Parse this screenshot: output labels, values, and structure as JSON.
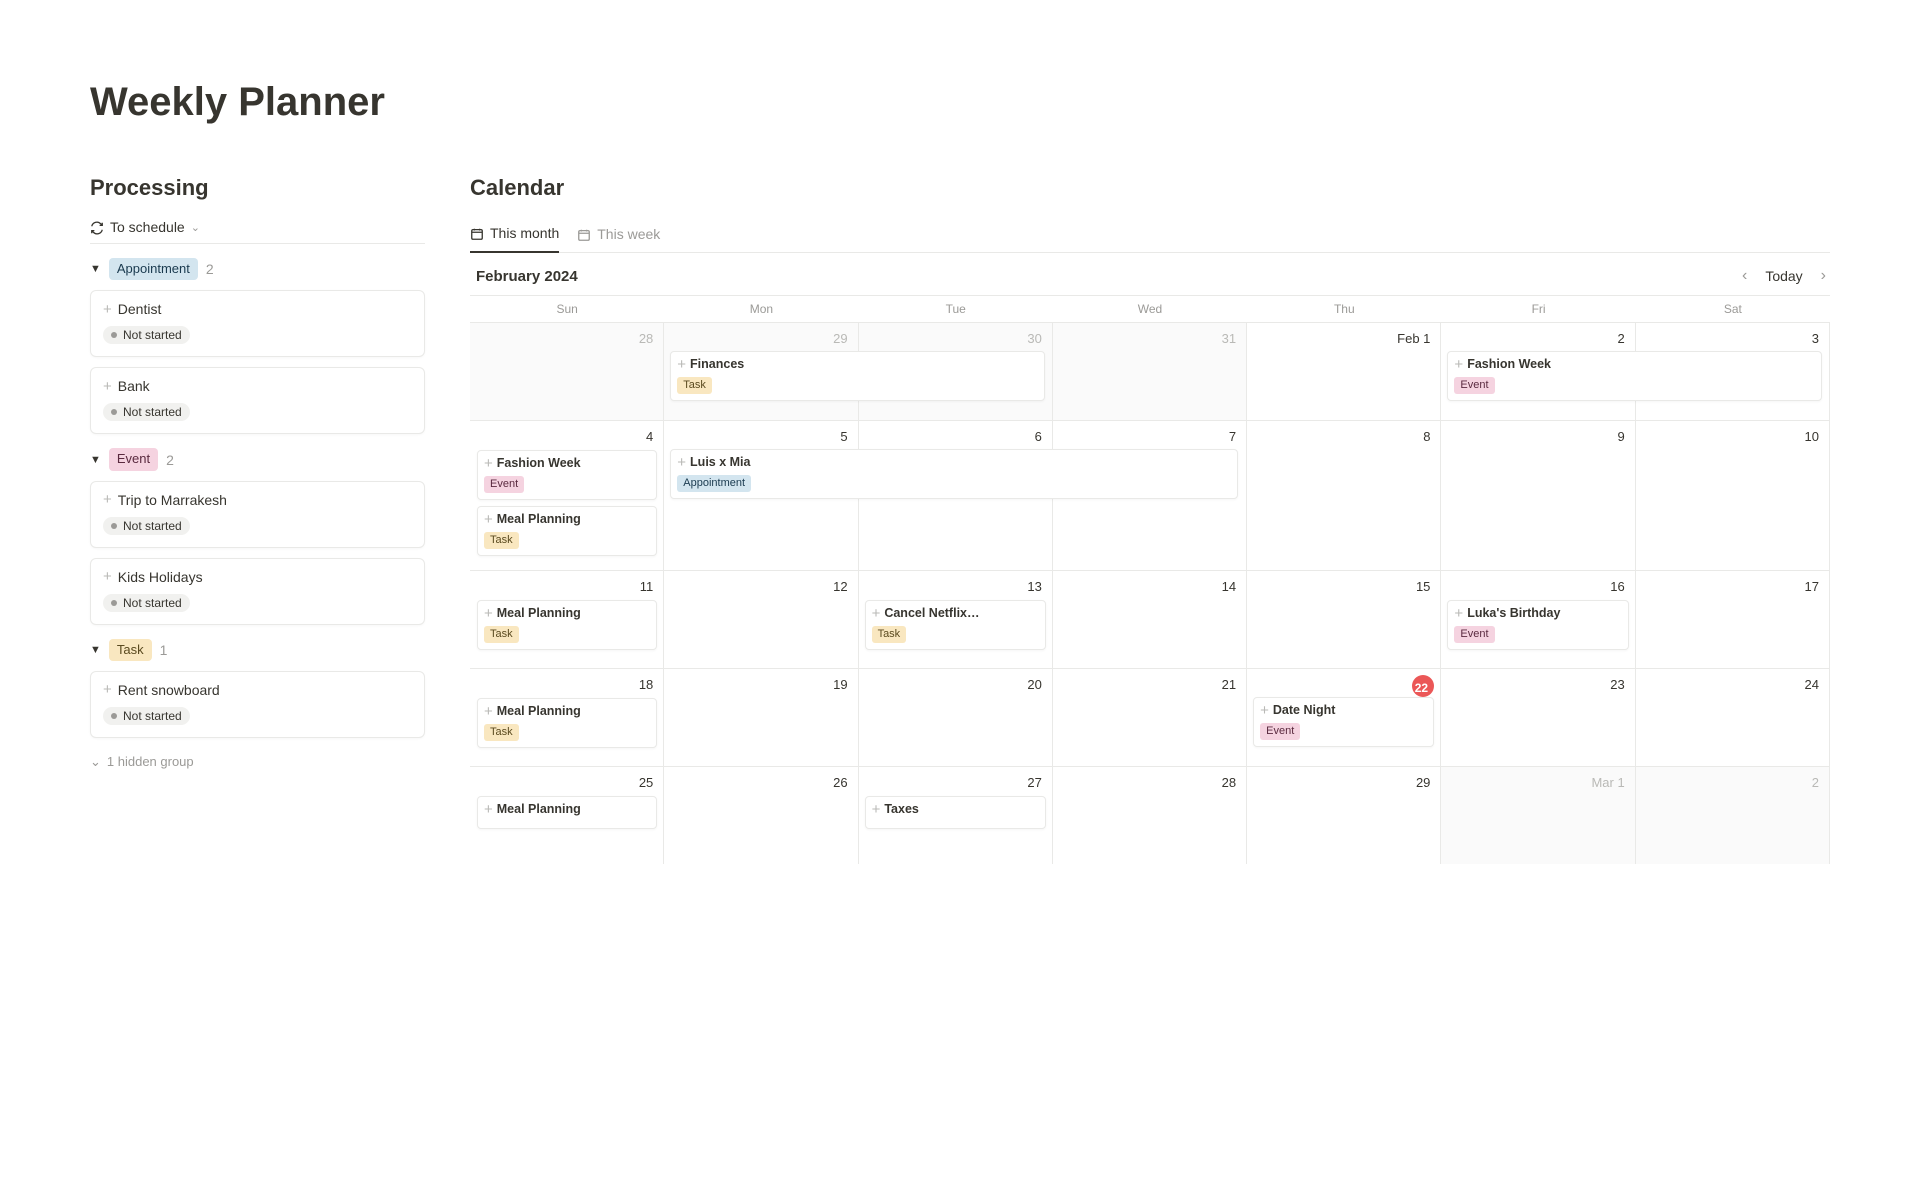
{
  "page_title": "Weekly Planner",
  "processing": {
    "title": "Processing",
    "view_tab": "To schedule",
    "groups": [
      {
        "name": "Appointment",
        "pill_class": "pill-appointment",
        "count": "2",
        "cards": [
          {
            "title": "Dentist",
            "status": "Not started"
          },
          {
            "title": "Bank",
            "status": "Not started"
          }
        ]
      },
      {
        "name": "Event",
        "pill_class": "pill-event",
        "count": "2",
        "cards": [
          {
            "title": "Trip to Marrakesh",
            "status": "Not started"
          },
          {
            "title": "Kids Holidays",
            "status": "Not started"
          }
        ]
      },
      {
        "name": "Task",
        "pill_class": "pill-task",
        "count": "1",
        "cards": [
          {
            "title": "Rent snowboard",
            "status": "Not started"
          }
        ]
      }
    ],
    "hidden_group_label": "1 hidden group"
  },
  "calendar": {
    "title": "Calendar",
    "tabs": [
      {
        "label": "This month",
        "active": true
      },
      {
        "label": "This week",
        "active": false
      }
    ],
    "month_label": "February 2024",
    "today_label": "Today",
    "dow": [
      "Sun",
      "Mon",
      "Tue",
      "Wed",
      "Thu",
      "Fri",
      "Sat"
    ],
    "weeks": [
      [
        {
          "num": "28",
          "outside": true,
          "events": []
        },
        {
          "num": "29",
          "outside": true,
          "events": [
            {
              "title": "Finances",
              "tag": "Task",
              "tag_class": "mini-task",
              "span": 2
            }
          ]
        },
        {
          "num": "30",
          "outside": true,
          "events": []
        },
        {
          "num": "31",
          "outside": true,
          "events": []
        },
        {
          "num": "Feb 1",
          "outside": false,
          "events": []
        },
        {
          "num": "2",
          "outside": false,
          "events": [
            {
              "title": "Fashion Week",
              "tag": "Event",
              "tag_class": "mini-event",
              "span": 2
            }
          ]
        },
        {
          "num": "3",
          "outside": false,
          "events": []
        }
      ],
      [
        {
          "num": "4",
          "outside": false,
          "events": [
            {
              "title": "Fashion Week",
              "tag": "Event",
              "tag_class": "mini-event"
            },
            {
              "title": "Meal Planning",
              "tag": "Task",
              "tag_class": "mini-task"
            }
          ]
        },
        {
          "num": "5",
          "outside": false,
          "events": [
            {
              "title": "Luis x Mia",
              "tag": "Appointment",
              "tag_class": "mini-appt",
              "span": 3
            }
          ]
        },
        {
          "num": "6",
          "outside": false,
          "events": []
        },
        {
          "num": "7",
          "outside": false,
          "events": []
        },
        {
          "num": "8",
          "outside": false,
          "events": []
        },
        {
          "num": "9",
          "outside": false,
          "events": []
        },
        {
          "num": "10",
          "outside": false,
          "events": []
        }
      ],
      [
        {
          "num": "11",
          "outside": false,
          "events": [
            {
              "title": "Meal Planning",
              "tag": "Task",
              "tag_class": "mini-task"
            }
          ]
        },
        {
          "num": "12",
          "outside": false,
          "events": []
        },
        {
          "num": "13",
          "outside": false,
          "events": [
            {
              "title": "Cancel Netflix…",
              "tag": "Task",
              "tag_class": "mini-task"
            }
          ]
        },
        {
          "num": "14",
          "outside": false,
          "events": []
        },
        {
          "num": "15",
          "outside": false,
          "events": []
        },
        {
          "num": "16",
          "outside": false,
          "events": [
            {
              "title": "Luka's Birthday",
              "tag": "Event",
              "tag_class": "mini-event"
            }
          ]
        },
        {
          "num": "17",
          "outside": false,
          "events": []
        }
      ],
      [
        {
          "num": "18",
          "outside": false,
          "events": [
            {
              "title": "Meal Planning",
              "tag": "Task",
              "tag_class": "mini-task"
            }
          ]
        },
        {
          "num": "19",
          "outside": false,
          "events": []
        },
        {
          "num": "20",
          "outside": false,
          "events": []
        },
        {
          "num": "21",
          "outside": false,
          "events": []
        },
        {
          "num": "22",
          "outside": false,
          "today": true,
          "events": [
            {
              "title": "Date Night",
              "tag": "Event",
              "tag_class": "mini-event"
            }
          ]
        },
        {
          "num": "23",
          "outside": false,
          "events": []
        },
        {
          "num": "24",
          "outside": false,
          "events": []
        }
      ],
      [
        {
          "num": "25",
          "outside": false,
          "events": [
            {
              "title": "Meal Planning",
              "tag": "",
              "tag_class": ""
            }
          ]
        },
        {
          "num": "26",
          "outside": false,
          "events": []
        },
        {
          "num": "27",
          "outside": false,
          "events": [
            {
              "title": "Taxes",
              "tag": "",
              "tag_class": ""
            }
          ]
        },
        {
          "num": "28",
          "outside": false,
          "events": []
        },
        {
          "num": "29",
          "outside": false,
          "events": []
        },
        {
          "num": "Mar 1",
          "outside": true,
          "events": []
        },
        {
          "num": "2",
          "outside": true,
          "events": []
        }
      ]
    ]
  }
}
